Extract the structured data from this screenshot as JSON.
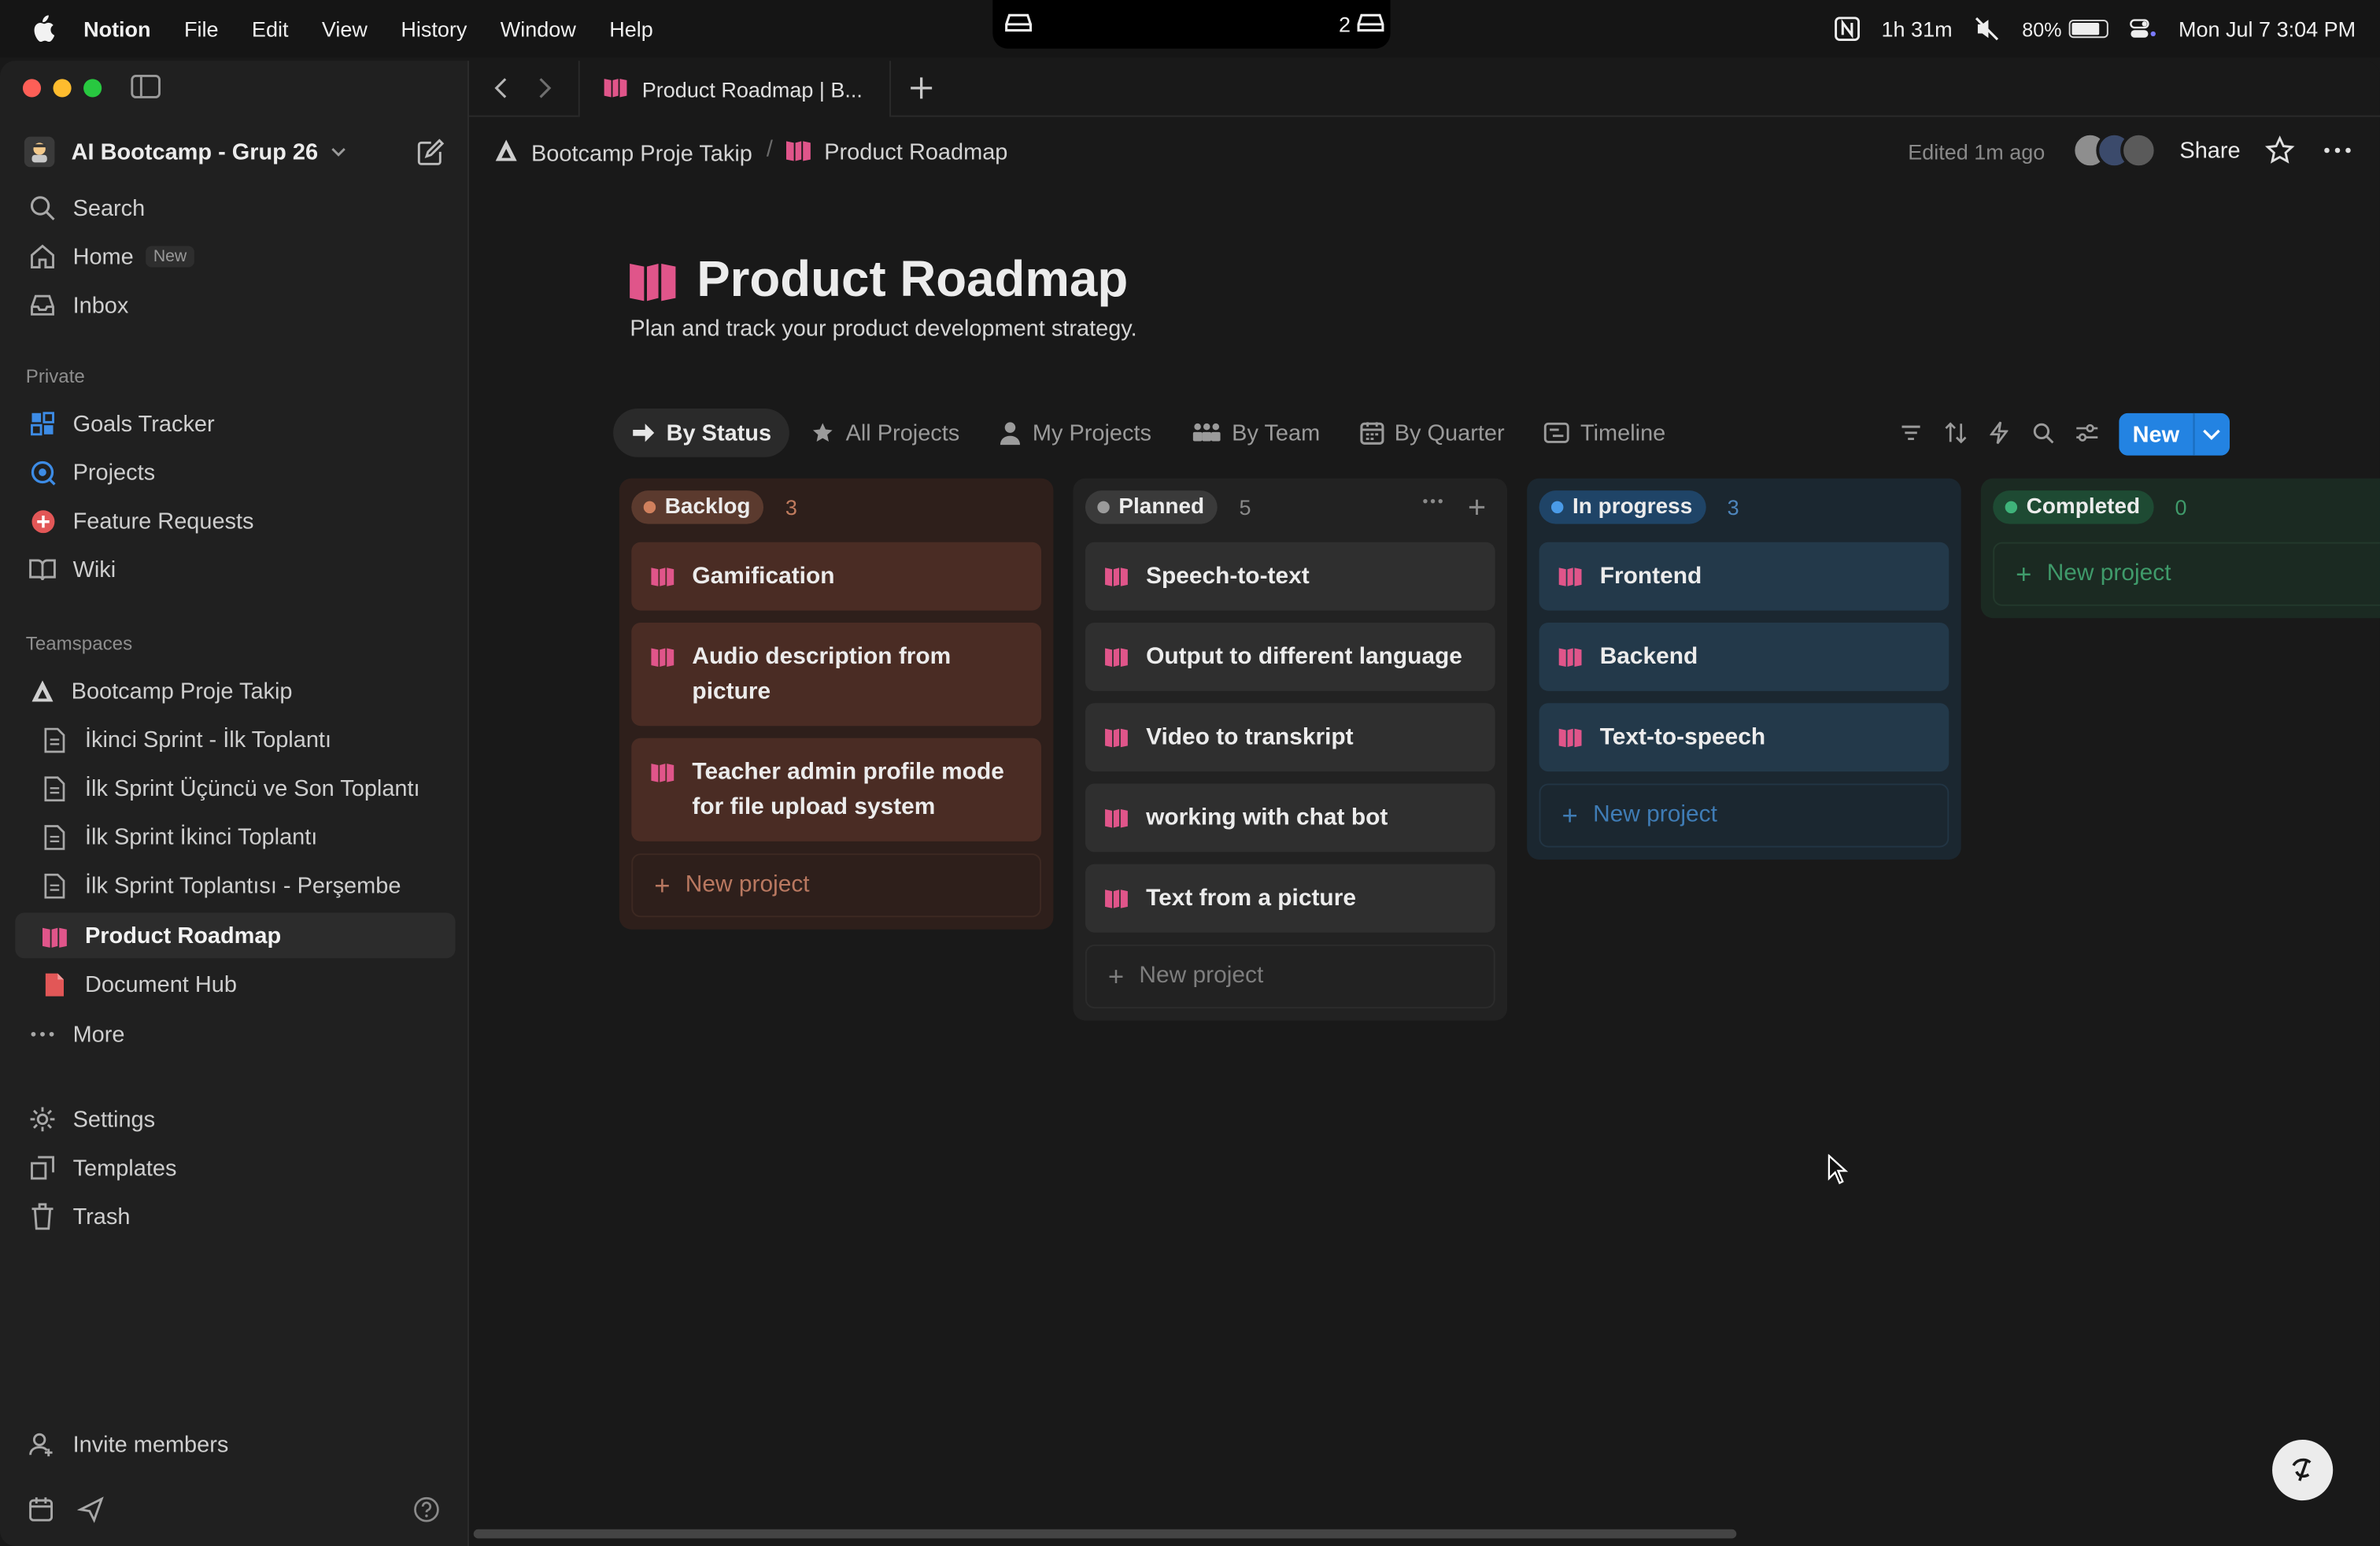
{
  "menubar": {
    "app_name": "Notion",
    "menus": [
      "File",
      "Edit",
      "View",
      "History",
      "Window",
      "Help"
    ],
    "notch_count": "2",
    "timer": "1h 31m",
    "battery_percent": "80%",
    "battery_level": 0.8,
    "datetime": "Mon Jul 7  3:04 PM"
  },
  "tabs": {
    "active_tab": "Product Roadmap | B..."
  },
  "sidebar": {
    "workspace": "AI Bootcamp - Grup 26",
    "search": "Search",
    "home": "Home",
    "home_badge": "New",
    "inbox": "Inbox",
    "private_header": "Private",
    "private_items": [
      "Goals Tracker",
      "Projects",
      "Feature Requests",
      "Wiki"
    ],
    "teamspaces_header": "Teamspaces",
    "teamspace": "Bootcamp Proje Takip",
    "pages": [
      "İkinci Sprint - İlk Toplantı",
      "İlk Sprint Üçüncü ve Son Toplantı",
      "İlk Sprint İkinci Toplantı",
      "İlk Sprint Toplantısı - Perşembe",
      "Product Roadmap",
      "Document Hub"
    ],
    "more": "More",
    "settings": "Settings",
    "templates": "Templates",
    "trash": "Trash",
    "invite": "Invite members"
  },
  "topbar": {
    "breadcrumb_root": "Bootcamp Proje Takip",
    "breadcrumb_page": "Product Roadmap",
    "edited": "Edited 1m ago",
    "share": "Share"
  },
  "page": {
    "title": "Product Roadmap",
    "description": "Plan and track your product development strategy."
  },
  "views": [
    "By Status",
    "All Projects",
    "My Projects",
    "By Team",
    "By Quarter",
    "Timeline"
  ],
  "new_button": "New",
  "new_project_label": "New project",
  "board": {
    "columns": [
      {
        "name": "Backlog",
        "count": "3",
        "cards": [
          "Gamification",
          "Audio description from picture",
          "Teacher admin profile mode for file upload system"
        ]
      },
      {
        "name": "Planned",
        "count": "5",
        "cards": [
          "Speech-to-text",
          "Output to different language",
          "Video to transkript",
          "working with chat bot",
          "Text from a picture"
        ]
      },
      {
        "name": "In progress",
        "count": "3",
        "cards": [
          "Frontend",
          "Backend",
          "Text-to-speech"
        ]
      },
      {
        "name": "Completed",
        "count": "0",
        "cards": []
      }
    ]
  },
  "colors": {
    "accent_blue": "#2383e2",
    "roadmap_icon": "#e0558a",
    "backlog_bg": "#2e1f1b",
    "backlog_card": "#4a2c24",
    "planned_bg": "#222222",
    "planned_card": "#2f2f2f",
    "inprogress_bg": "#1b2730",
    "inprogress_card": "#23394a",
    "completed_bg": "#1b2a22"
  }
}
